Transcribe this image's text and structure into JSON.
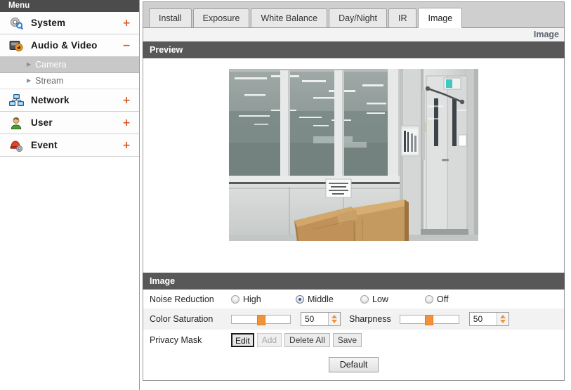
{
  "sidebar": {
    "header": "Menu",
    "items": [
      {
        "label": "System",
        "icon": "system-gear-magnifier-icon",
        "toggle": "+",
        "expanded": false
      },
      {
        "label": "Audio & Video",
        "icon": "camera-icon",
        "toggle": "−",
        "expanded": true
      },
      {
        "label": "Network",
        "icon": "network-icon",
        "toggle": "+",
        "expanded": false
      },
      {
        "label": "User",
        "icon": "user-icon",
        "toggle": "+",
        "expanded": false
      },
      {
        "label": "Event",
        "icon": "event-alarm-icon",
        "toggle": "+",
        "expanded": false
      }
    ],
    "submenu": [
      {
        "label": "Camera",
        "active": true
      },
      {
        "label": "Stream",
        "active": false
      }
    ]
  },
  "tabs": [
    {
      "label": "Install",
      "active": false
    },
    {
      "label": "Exposure",
      "active": false
    },
    {
      "label": "White Balance",
      "active": false
    },
    {
      "label": "Day/Night",
      "active": false
    },
    {
      "label": "IR",
      "active": false
    },
    {
      "label": "Image",
      "active": true
    }
  ],
  "breadcrumb": "Image",
  "preview": {
    "section_title": "Preview",
    "alt": "camera-preview-office-glass-partition-with-cardboard-boxes"
  },
  "image_settings": {
    "section_title": "Image",
    "noise_reduction": {
      "label": "Noise Reduction",
      "options": [
        "High",
        "Middle",
        "Low",
        "Off"
      ],
      "selected": "Middle"
    },
    "color_saturation": {
      "label": "Color Saturation",
      "value": "50",
      "slider_percent": 50
    },
    "sharpness": {
      "label": "Sharpness",
      "value": "50",
      "slider_percent": 50
    },
    "privacy_mask": {
      "label": "Privacy Mask",
      "buttons": [
        {
          "label": "Edit",
          "state": "focused"
        },
        {
          "label": "Add",
          "state": "disabled"
        },
        {
          "label": "Delete All",
          "state": "normal"
        },
        {
          "label": "Save",
          "state": "normal"
        }
      ]
    },
    "default_button": "Default"
  },
  "colors": {
    "accent_orange": "#d9531e",
    "slider_orange": "#f0923a",
    "section_bar": "#585858",
    "menu_header": "#4c4c4c",
    "radio_selected": "#1b5fb5",
    "breadcrumb_text": "#5b6470"
  }
}
